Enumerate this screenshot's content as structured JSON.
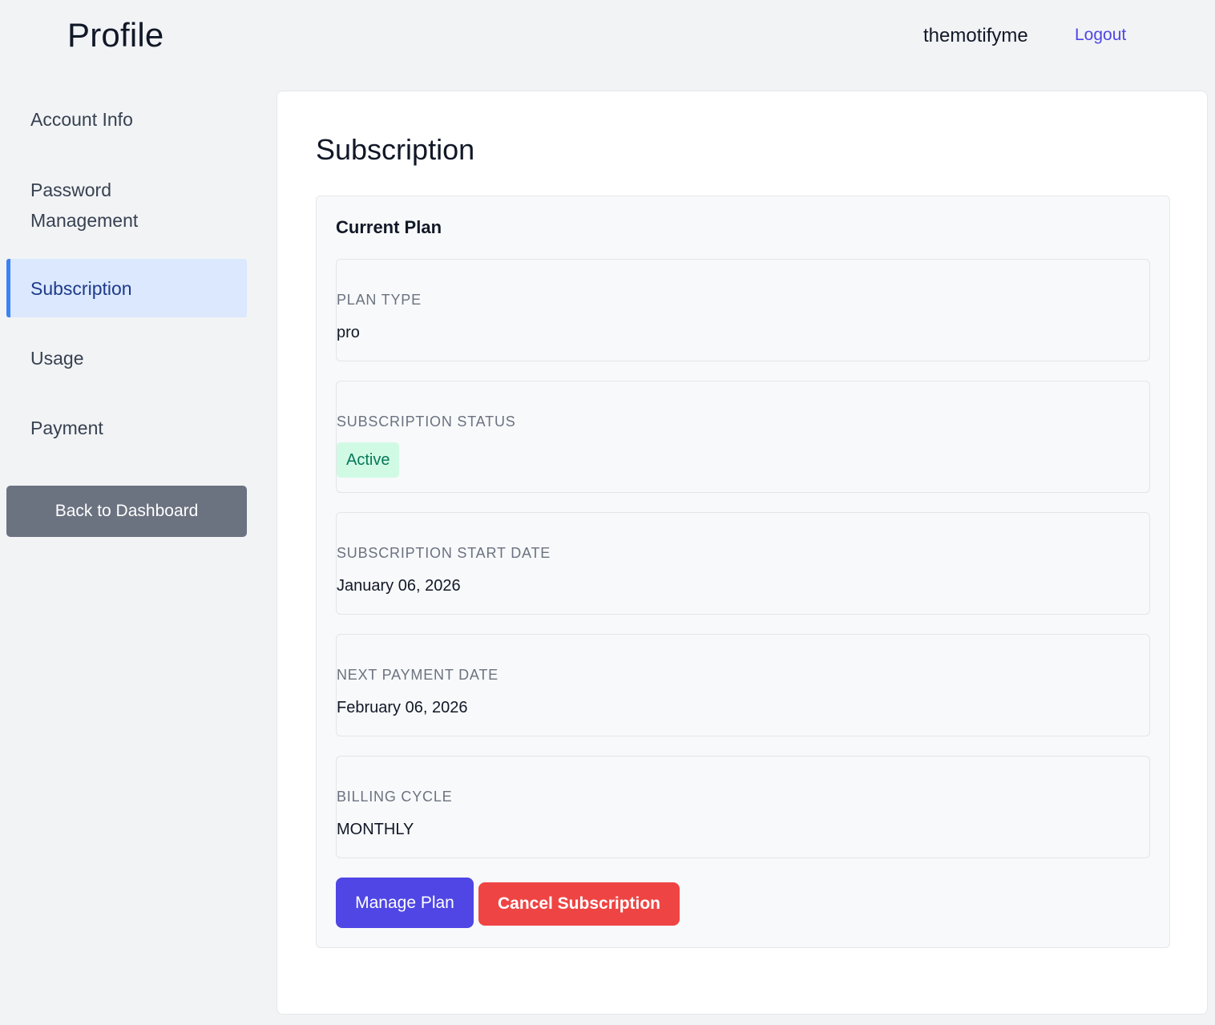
{
  "header": {
    "title": "Profile",
    "username": "themotifyme",
    "logout_label": "Logout"
  },
  "sidebar": {
    "items": [
      {
        "label": "Account Info"
      },
      {
        "label": "Password Management"
      },
      {
        "label": "Subscription",
        "active": true
      },
      {
        "label": "Usage"
      },
      {
        "label": "Payment"
      }
    ],
    "back_button_label": "Back to Dashboard"
  },
  "main": {
    "section_title": "Subscription",
    "panel_heading": "Current Plan",
    "fields": {
      "plan_type": {
        "label": "PLAN TYPE",
        "value": "pro"
      },
      "status": {
        "label": "SUBSCRIPTION STATUS",
        "value": "Active"
      },
      "start_date": {
        "label": "SUBSCRIPTION START DATE",
        "value": "January 06, 2026"
      },
      "next_payment": {
        "label": "NEXT PAYMENT DATE",
        "value": "February 06, 2026"
      },
      "billing_cycle": {
        "label": "BILLING CYCLE",
        "value": "MONTHLY"
      }
    },
    "manage_button_label": "Manage Plan",
    "cancel_button_label": "Cancel Subscription"
  },
  "colors": {
    "accent": "#4f46e5",
    "danger": "#ef4444",
    "active_nav_bg": "#dbe8fd",
    "active_nav_bar": "#3b82f6",
    "status_active_bg": "#d1fae5",
    "status_active_text": "#047857",
    "secondary_button": "#6b7280"
  }
}
